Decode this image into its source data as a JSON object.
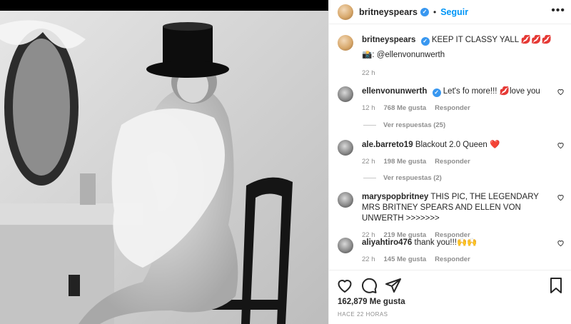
{
  "post": {
    "username": "britneyspears",
    "follow_label": "Seguir",
    "more_label": "•••",
    "dot": "•"
  },
  "caption": {
    "username": "britneyspears",
    "text": "KEEP IT CLASSY YALL 💋💋💋",
    "credit": "📸: @ellenvonunwerth",
    "time": "22 h"
  },
  "comments": [
    {
      "username": "ellenvonunwerth",
      "text": "Let's fo more!!! 💋love you",
      "time": "12 h",
      "likes": "768 Me gusta",
      "reply": "Responder",
      "replies": "Ver respuestas (25)",
      "verified": true
    },
    {
      "username": "ale.barreto19",
      "text": "Blackout 2.0 Queen ❤️",
      "time": "22 h",
      "likes": "198 Me gusta",
      "reply": "Responder",
      "replies": "Ver respuestas (2)",
      "verified": false
    },
    {
      "username": "maryspopbritney",
      "text": "THIS PIC, THE LEGENDARY MRS BRITNEY SPEARS AND ELLEN VON UNWERTH >>>>>>>",
      "time": "22 h",
      "likes": "219 Me gusta",
      "reply": "Responder",
      "verified": false
    },
    {
      "username": "aliyahtiro476",
      "text": "thank you!!!🙌🙌",
      "time": "22 h",
      "likes": "145 Me gusta",
      "reply": "Responder",
      "verified": false
    }
  ],
  "footer": {
    "likes": "162,879 Me gusta",
    "ago": "HACE 22 HORAS"
  },
  "icons": {
    "heart": "heart-icon",
    "comment": "comment-icon",
    "share": "share-icon",
    "save": "bookmark-icon",
    "verified": "verified-badge-icon"
  },
  "colors": {
    "accent": "#0095f6",
    "verified": "#3897f0",
    "muted": "#8e8e8e",
    "text": "#262626"
  }
}
